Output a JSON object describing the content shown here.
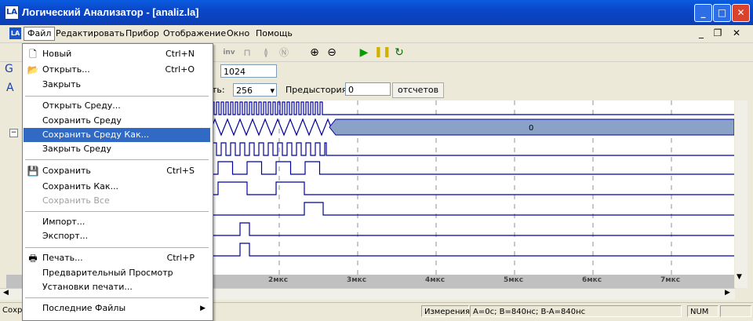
{
  "window": {
    "title": "Логический Анализатор - [analiz.la]",
    "app_icon": "LA"
  },
  "menubar": {
    "file": "Файл",
    "edit": "Редактировать",
    "device": "Прибор",
    "view": "Отображение",
    "window": "Окно",
    "help": "Помощь"
  },
  "controls": {
    "samples_value": "1024",
    "depth_label_fragment": "ть:",
    "depth_value": "256",
    "pretrigger_label": "Предыстория:",
    "pretrigger_value": "0",
    "samples_unit": "отсчетов",
    "row2_letter": "G",
    "row3_letter": "A"
  },
  "toolbar": {
    "inv_label": "inv"
  },
  "plot": {
    "bus_value": "0",
    "time_ticks": [
      "2мкс",
      "3мкс",
      "4мкс",
      "5мкс",
      "6мкс",
      "7мкс"
    ]
  },
  "status": {
    "left": "Сохр",
    "measure_label": "Измерения",
    "measure_value": "A=0с; B=840нс; B-A=840нс",
    "num": "NUM"
  },
  "file_menu": {
    "items": [
      {
        "label": "Новый",
        "shortcut": "Ctrl+N",
        "icon": "new-doc-icon"
      },
      {
        "label": "Открыть...",
        "shortcut": "Ctrl+O",
        "icon": "open-folder-icon"
      },
      {
        "label": "Закрыть",
        "shortcut": ""
      },
      {
        "label": "Открыть Среду...",
        "shortcut": ""
      },
      {
        "label": "Сохранить Среду",
        "shortcut": ""
      },
      {
        "label": "Сохранить Среду Как...",
        "shortcut": ""
      },
      {
        "label": "Закрыть Среду",
        "shortcut": ""
      },
      {
        "label": "Сохранить",
        "shortcut": "Ctrl+S",
        "icon": "save-disk-icon"
      },
      {
        "label": "Сохранить Как...",
        "shortcut": ""
      },
      {
        "label": "Сохранить Все",
        "shortcut": ""
      },
      {
        "label": "Импорт...",
        "shortcut": ""
      },
      {
        "label": "Экспорт...",
        "shortcut": ""
      },
      {
        "label": "Печать...",
        "shortcut": "Ctrl+P",
        "icon": "printer-icon"
      },
      {
        "label": "Предварительный Просмотр",
        "shortcut": ""
      },
      {
        "label": "Установки печати...",
        "shortcut": ""
      },
      {
        "label": "Последние Файлы",
        "shortcut": ""
      }
    ]
  },
  "colors": {
    "signal": "#0000a0",
    "bus_fill": "#8aa2c8",
    "highlight": "#316ac5"
  }
}
